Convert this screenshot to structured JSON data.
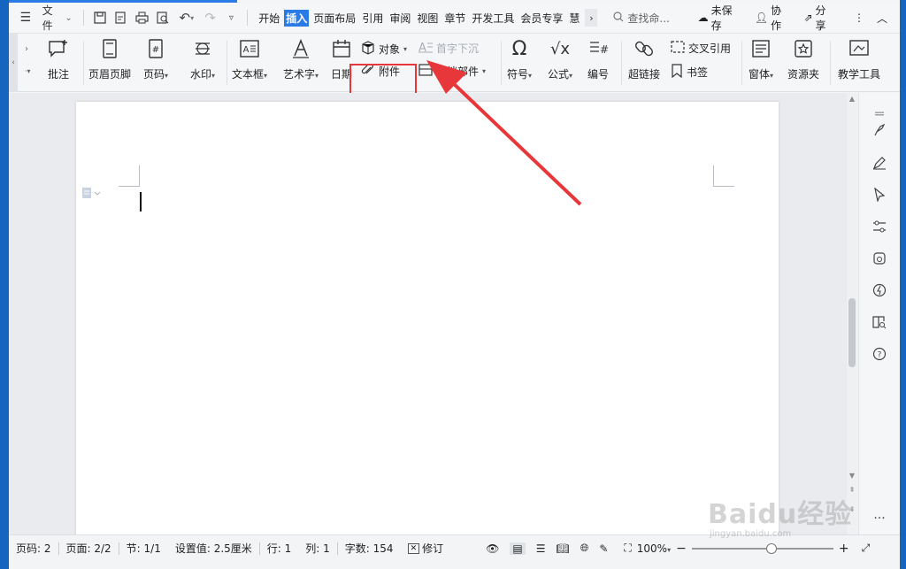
{
  "menu": {
    "file_label": "文件",
    "tabs": [
      "开始",
      "插入",
      "页面布局",
      "引用",
      "审阅",
      "视图",
      "章节",
      "开发工具",
      "会员专享",
      "慧"
    ],
    "active_tab": "插入",
    "search_placeholder": "查找命...",
    "unsaved": "未保存",
    "collab": "协作",
    "share": "分享"
  },
  "ribbon": {
    "comment": "批注",
    "header_footer": "页眉页脚",
    "page_number": "页码",
    "watermark": "水印",
    "textbox": "文本框",
    "wordart": "艺术字",
    "date": "日期",
    "object": "对象",
    "attachment": "附件",
    "dropcap": "首字下沉",
    "doc_parts": "文档部件",
    "symbol": "符号",
    "formula": "公式",
    "numbering": "编号",
    "hyperlink": "超链接",
    "cross_ref": "交叉引用",
    "bookmark": "书签",
    "form": "窗体",
    "resource": "资源夹",
    "teach_tools": "教学工具"
  },
  "status": {
    "page_num": "页码: 2",
    "pages": "页面: 2/2",
    "section": "节: 1/1",
    "setting": "设置值: 2.5厘米",
    "row": "行: 1",
    "col": "列: 1",
    "word_count": "字数: 154",
    "revise": "修订",
    "zoom": "100%",
    "zoom_level": 1.0
  },
  "watermark": {
    "main": "Baidu经验",
    "sub": "jingyan.baidu.com"
  },
  "colors": {
    "accent": "#2b7be6",
    "highlight": "#e8373a",
    "arrow": "#e8373a"
  }
}
